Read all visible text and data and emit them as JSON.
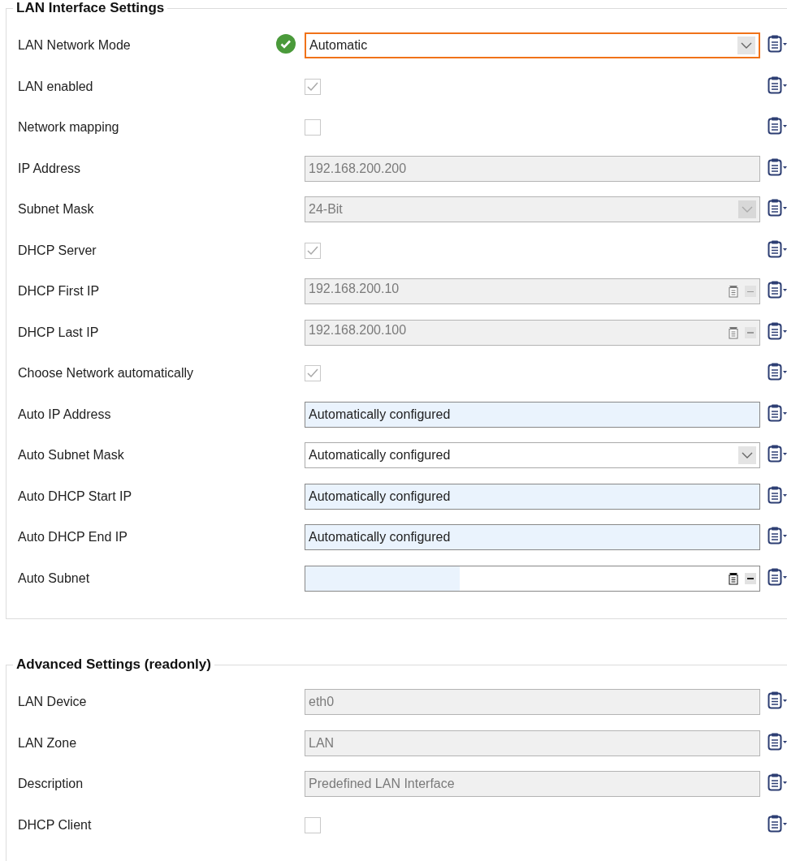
{
  "sections": [
    {
      "title": "LAN Interface Settings",
      "rows": [
        {
          "label": "LAN Network Mode",
          "kind": "select",
          "value": "Automatic",
          "disabled": false,
          "autofilled": false,
          "focused": true,
          "valid": true
        },
        {
          "label": "LAN enabled",
          "kind": "checkbox",
          "checked": true,
          "disabled": true
        },
        {
          "label": "Network mapping",
          "kind": "checkbox",
          "checked": false,
          "disabled": true
        },
        {
          "label": "IP Address",
          "kind": "text",
          "value": "192.168.200.200",
          "disabled": true,
          "autofilled": false,
          "focused": false,
          "valid": false
        },
        {
          "label": "Subnet Mask",
          "kind": "select",
          "value": "24-Bit",
          "disabled": true,
          "autofilled": false,
          "focused": false,
          "valid": false
        },
        {
          "label": "DHCP Server",
          "kind": "checkbox",
          "checked": true,
          "disabled": true
        },
        {
          "label": "DHCP First IP",
          "kind": "ipfield",
          "value": "192.168.200.10",
          "disabled": true,
          "autofilled": false,
          "focused": false,
          "valid": false
        },
        {
          "label": "DHCP Last IP",
          "kind": "ipfield",
          "value": "192.168.200.100",
          "disabled": true,
          "autofilled": false,
          "focused": false,
          "valid": false
        },
        {
          "label": "Choose Network automatically",
          "kind": "checkbox",
          "checked": true,
          "disabled": true
        },
        {
          "label": "Auto IP Address",
          "kind": "text",
          "value": "Automatically configured",
          "disabled": false,
          "autofilled": true,
          "focused": false,
          "valid": false
        },
        {
          "label": "Auto Subnet Mask",
          "kind": "select",
          "value": "Automatically configured",
          "disabled": false,
          "autofilled": false,
          "focused": false,
          "valid": false
        },
        {
          "label": "Auto DHCP Start IP",
          "kind": "text",
          "value": "Automatically configured",
          "disabled": false,
          "autofilled": true,
          "focused": false,
          "valid": false
        },
        {
          "label": "Auto DHCP End IP",
          "kind": "text",
          "value": "Automatically configured",
          "disabled": false,
          "autofilled": true,
          "focused": false,
          "valid": false
        },
        {
          "label": "Auto Subnet",
          "kind": "ipfield",
          "disabled": false,
          "autofilled": true,
          "focused": false,
          "valid": false
        }
      ]
    },
    {
      "title": "Advanced Settings (readonly)",
      "rows": [
        {
          "label": "LAN Device",
          "kind": "text",
          "value": "eth0",
          "disabled": true,
          "autofilled": false,
          "focused": false,
          "valid": false
        },
        {
          "label": "LAN Zone",
          "kind": "text",
          "value": "LAN",
          "disabled": true,
          "autofilled": false,
          "focused": false,
          "valid": false
        },
        {
          "label": "Description",
          "kind": "text",
          "value": "Predefined LAN Interface",
          "disabled": true,
          "autofilled": false,
          "focused": false,
          "valid": false
        },
        {
          "label": "DHCP Client",
          "kind": "checkbox",
          "checked": false,
          "disabled": true
        }
      ]
    }
  ]
}
